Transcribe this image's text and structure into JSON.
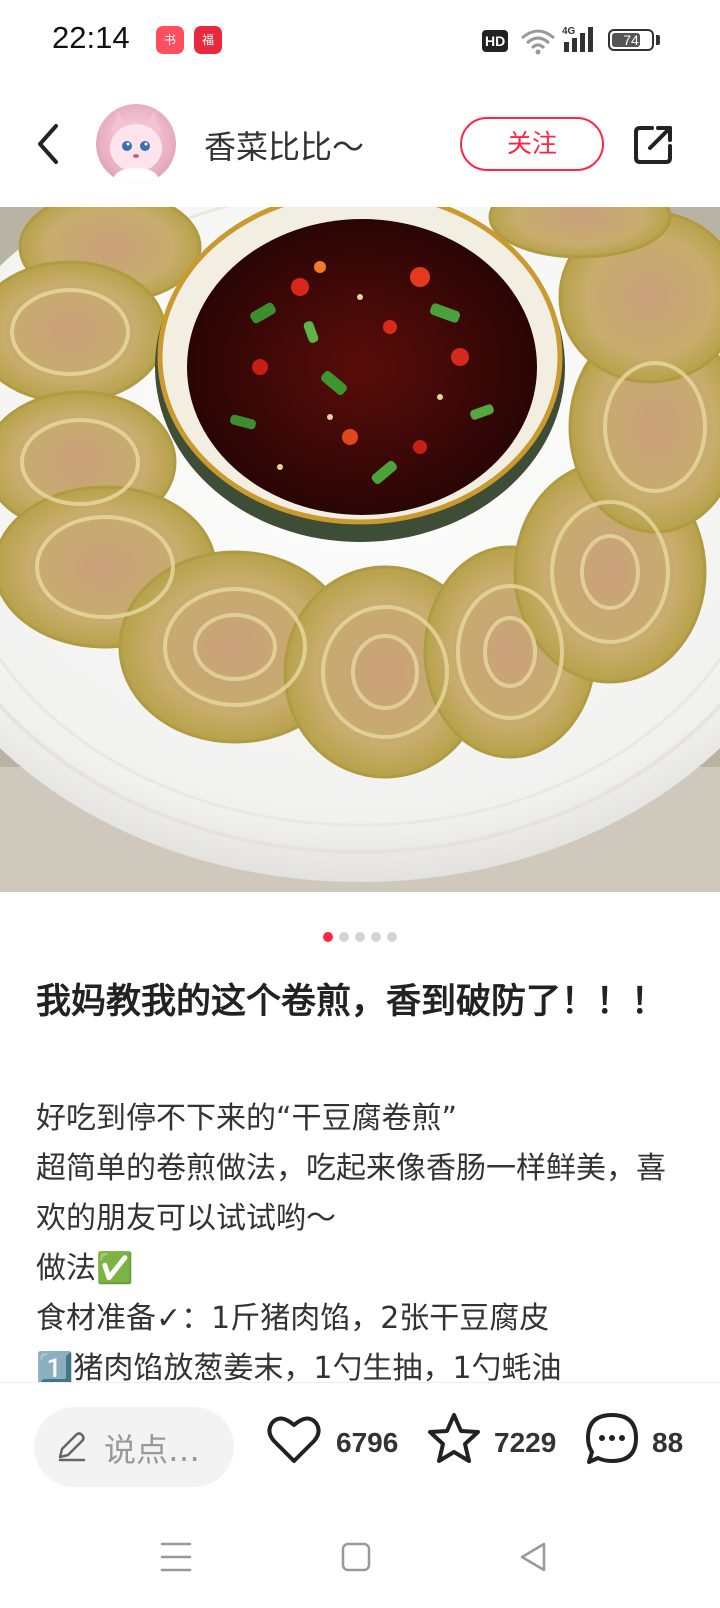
{
  "status_bar": {
    "time": "22:14",
    "hd_badge": "HD",
    "network": "4G",
    "battery": "74",
    "battery_level": 0.74,
    "app_icons": [
      "小红书",
      "福运节"
    ]
  },
  "header": {
    "back_icon": "chevron-left-icon",
    "author_name": "香菜比比～",
    "follow_label": "关注",
    "share_icon": "share-external-icon"
  },
  "gallery": {
    "total_images": 5,
    "current_index": 1
  },
  "post": {
    "title": "我妈教我的这个卷煎，香到破防了！！！",
    "body_lines": [
      "好吃到停不下来的“干豆腐卷煎”",
      "超简单的卷煎做法，吃起来像香肠一样鲜美，喜欢的朋友可以试试哟～",
      "做法✅",
      "食材准备✓：1斤猪肉馅，2张干豆腐皮",
      "1️⃣猪肉馅放葱姜末，1勺生抽，1勺蚝油"
    ]
  },
  "actions": {
    "comment_placeholder": "说点…",
    "likes": "6796",
    "collects": "7229",
    "comments": "88"
  },
  "colors": {
    "accent": "#ff2442"
  }
}
